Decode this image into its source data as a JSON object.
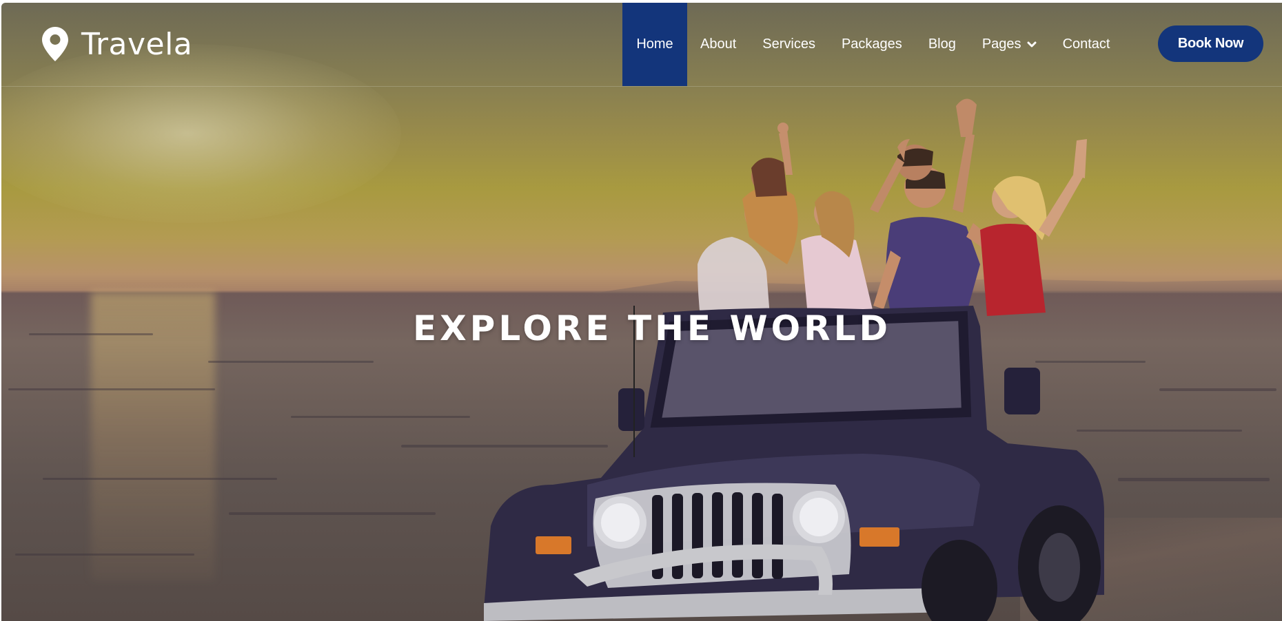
{
  "brand": {
    "name": "Travela",
    "icon": "map-pin-icon",
    "accent_color": "#13357b"
  },
  "nav": {
    "items": [
      {
        "label": "Home",
        "active": true
      },
      {
        "label": "About",
        "active": false
      },
      {
        "label": "Services",
        "active": false
      },
      {
        "label": "Packages",
        "active": false
      },
      {
        "label": "Blog",
        "active": false
      },
      {
        "label": "Pages",
        "active": false,
        "has_dropdown": true
      },
      {
        "label": "Contact",
        "active": false
      }
    ],
    "cta_label": "Book Now"
  },
  "hero": {
    "title": "EXPLORE THE WORLD",
    "image": "friends-in-jeep-on-beach-at-sunset"
  }
}
